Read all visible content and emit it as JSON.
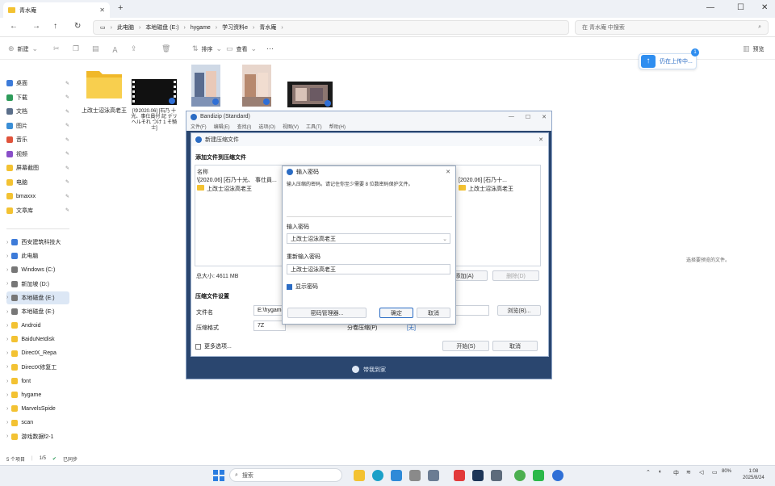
{
  "window": {
    "tab_title": "青水庵",
    "new_tab": "+",
    "min": "—",
    "max": "☐",
    "close": "✕"
  },
  "address": {
    "crumbs": [
      "此电脑",
      "本地磁盘 (E:)",
      "hygame",
      "学习资料e",
      "青水庵"
    ],
    "search_placeholder": "在 青水庵 中搜索"
  },
  "toolbar": {
    "new": "新建",
    "sort": "排序",
    "view": "查看",
    "more": "···",
    "preview": "预览"
  },
  "sidebar": {
    "quick": [
      {
        "label": "桌面",
        "color": "#3d7bd9"
      },
      {
        "label": "下载",
        "color": "#2e9b5a"
      },
      {
        "label": "文档",
        "color": "#5b6f8a"
      },
      {
        "label": "图片",
        "color": "#3a8ed6"
      },
      {
        "label": "音乐",
        "color": "#e0533b"
      },
      {
        "label": "视频",
        "color": "#8a4fc9"
      },
      {
        "label": "屏幕截图",
        "color": "#f3c232"
      },
      {
        "label": "电脑",
        "color": "#f3c232"
      },
      {
        "label": "bmaxxx",
        "color": "#f3c232"
      },
      {
        "label": "文章库",
        "color": "#f3c232"
      }
    ],
    "tree": [
      {
        "label": "西安建筑科技大",
        "color": "#3d7bd9",
        "selected": false
      },
      {
        "label": "此电脑",
        "color": "#3d7bd9",
        "selected": false
      },
      {
        "label": "Windows (C:)",
        "color": "#777777",
        "selected": false
      },
      {
        "label": "新加坡 (D:)",
        "color": "#777777",
        "selected": false
      },
      {
        "label": "本地磁盘 (E:)",
        "color": "#777777",
        "selected": true
      },
      {
        "label": "本地磁盘 (E:)",
        "color": "#777777",
        "selected": false
      },
      {
        "label": "Android",
        "color": "#f3c232",
        "selected": false
      },
      {
        "label": "BaiduNetdisk",
        "color": "#f3c232",
        "selected": false
      },
      {
        "label": "DirectX_Repa",
        "color": "#f3c232",
        "selected": false
      },
      {
        "label": "DirectX修复工",
        "color": "#f3c232",
        "selected": false
      },
      {
        "label": "font",
        "color": "#f3c232",
        "selected": false
      },
      {
        "label": "hygame",
        "color": "#f3c232",
        "selected": false
      },
      {
        "label": "MarvelsSpide",
        "color": "#f3c232",
        "selected": false
      },
      {
        "label": "scan",
        "color": "#f3c232",
        "selected": false
      },
      {
        "label": "游戏数据f2-1",
        "color": "#f3c232",
        "selected": false
      }
    ]
  },
  "files": [
    {
      "name": "上改士沼泳高老王",
      "kind": "folder"
    },
    {
      "name": "[ゆ2020.06] [石乃 十光、事仕員付 記 デリヘルそれ つけ 1 そ騎士]",
      "kind": "video"
    },
    {
      "name": "",
      "kind": "image"
    },
    {
      "name": "",
      "kind": "image"
    },
    {
      "name": "",
      "kind": "video2"
    }
  ],
  "upload": {
    "label": "仍在上传中...",
    "count": "1"
  },
  "empty_hint": "选择要预览的文件。",
  "bandizip": {
    "title": "Bandizip (Standard)",
    "menu": [
      "文件(F)",
      "编辑(E)",
      "查找(I)",
      "选项(O)",
      "视图(V)",
      "工具(T)",
      "帮助(H)"
    ],
    "bottom": "带我到家",
    "new_archive": {
      "title": "新建压缩文件",
      "section_files": "添加文件到压缩文件",
      "col_name": "名称",
      "file1": "\\[2020.06] [石乃十光、 事仕員...",
      "file2": "上改士沼泳高老王",
      "file3": "[2020.06] [石乃十...",
      "file4": "上改士沼泳高老王",
      "total_size": "总大小: 4611 MB",
      "btn_add": "添加(A)",
      "btn_remove": "删除(D)",
      "section_settings": "压缩文件设置",
      "label_filename": "文件名",
      "filename_value": "E:\\hygame",
      "btn_browse": "浏览(B)...",
      "label_format": "压缩格式",
      "format_value": "7Z",
      "label_split": "分卷压缩(P)",
      "split_value": "[无]",
      "more_options": "更多选项...",
      "btn_start": "开始(S)",
      "btn_cancel": "取消"
    },
    "password": {
      "title": "输入密码",
      "desc": "输入压缩的密码。请记住你至少需要 8 位数密码保护文件。",
      "label_pw": "输入密码",
      "pw_value": "上改士沼泳高老王",
      "label_confirm": "重新输入密码",
      "confirm_value": "上改士沼泳高老王",
      "show_pw": "显示密码",
      "btn_manager": "密码管理器...",
      "btn_ok": "确定",
      "btn_cancel": "取消"
    }
  },
  "status": {
    "count": "5 个项目",
    "selected": "1/5",
    "sync": "已同步"
  },
  "taskbar": {
    "search": "搜索",
    "battery": "80%",
    "time": "1:08",
    "date": "2025/8/24"
  }
}
